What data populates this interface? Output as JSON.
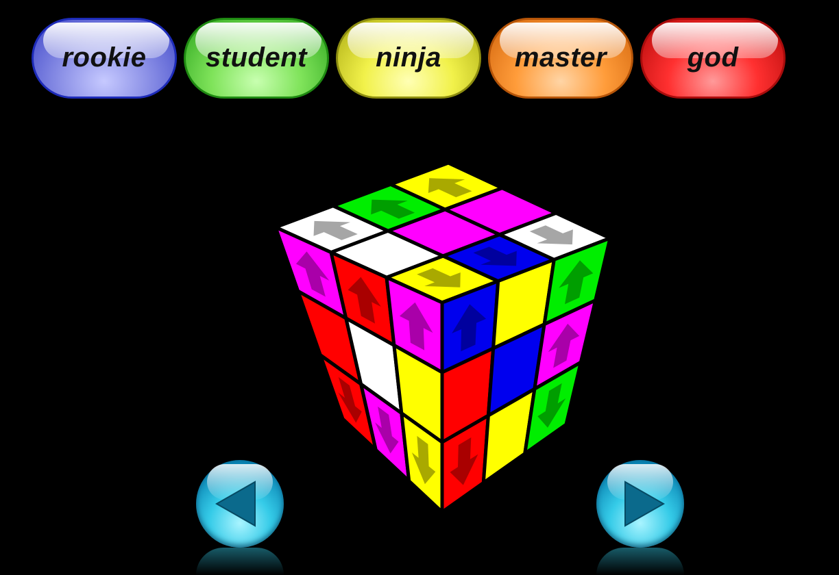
{
  "levels": [
    {
      "id": "rookie",
      "label": "rookie",
      "color": "#8a8fe6"
    },
    {
      "id": "student",
      "label": "student",
      "color": "#7fe35a"
    },
    {
      "id": "ninja",
      "label": "ninja",
      "color": "#f1f14a"
    },
    {
      "id": "master",
      "label": "master",
      "color": "#ff9c3a"
    },
    {
      "id": "god",
      "label": "god",
      "color": "#ff3030"
    }
  ],
  "navigation": {
    "prev_icon": "triangle-left-icon",
    "next_icon": "triangle-right-icon"
  },
  "cube": {
    "colors": {
      "W": "#ffffff",
      "Y": "#ffff00",
      "G": "#00ee00",
      "B": "#0000ee",
      "R": "#ff0000",
      "M": "#ff00ff"
    },
    "top": [
      [
        "W:up",
        "G:up",
        "Y:up"
      ],
      [
        "W",
        "M",
        "M"
      ],
      [
        "Y:down",
        "B:down",
        "W:down"
      ]
    ],
    "left": [
      [
        "M:up",
        "R:up",
        "M:up"
      ],
      [
        "R",
        "W",
        "Y"
      ],
      [
        "R:down",
        "M:down",
        "Y:down"
      ]
    ],
    "right": [
      [
        "B:up",
        "Y",
        "G:up"
      ],
      [
        "R",
        "B",
        "M:up"
      ],
      [
        "R:down",
        "Y",
        "G:down"
      ]
    ]
  }
}
